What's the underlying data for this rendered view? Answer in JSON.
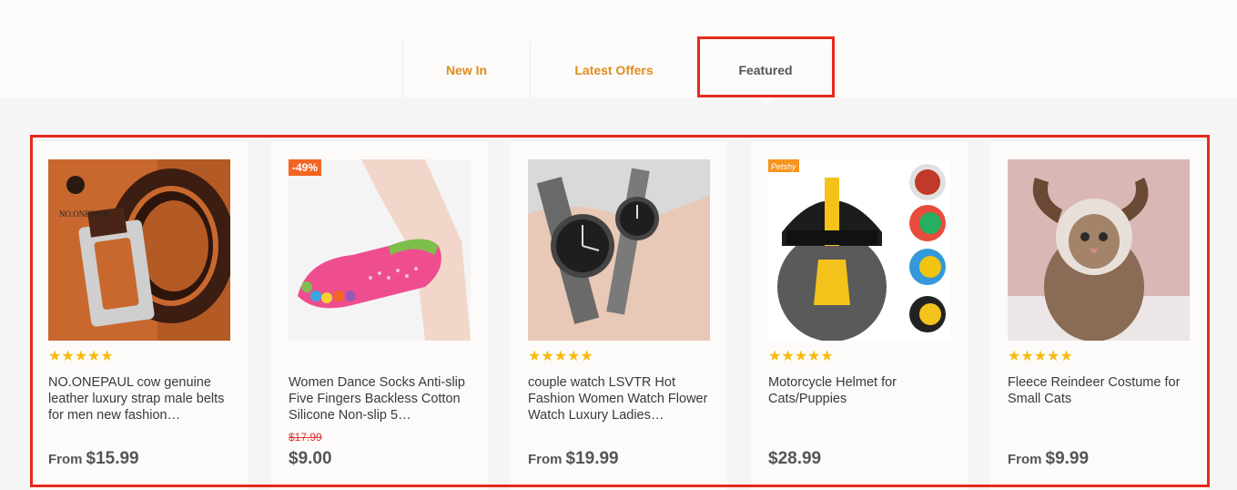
{
  "tabs": [
    {
      "label": "New In"
    },
    {
      "label": "Latest Offers"
    },
    {
      "label": "Featured",
      "active": true
    }
  ],
  "products": [
    {
      "title": "NO.ONEPAUL cow genuine leather luxury strap male belts for men new fashion…",
      "stars": "★★★★★",
      "rating": 4.5,
      "price_prefix": "From",
      "price": "$15.99",
      "image_icon": "leather-belt",
      "logo_text": "NO.ONEPAUL"
    },
    {
      "title": "Women Dance Socks Anti-slip Five Fingers Backless Cotton Silicone Non-slip 5…",
      "stars": "★★★★★",
      "rating": 0,
      "badge": "-49%",
      "old_price": "$17.99",
      "price": "$9.00",
      "image_icon": "toe-socks"
    },
    {
      "title": "couple watch LSVTR Hot Fashion Women Watch Flower Watch Luxury Ladies…",
      "stars": "★★★★★",
      "rating": 4.5,
      "price_prefix": "From",
      "price": "$19.99",
      "image_icon": "wrist-watches"
    },
    {
      "title": "Motorcycle Helmet for Cats/Puppies",
      "stars": "★★★★★",
      "rating": 4.5,
      "price": "$28.99",
      "image_icon": "cat-helmet",
      "brand_text": "Petshy"
    },
    {
      "title": "Fleece Reindeer Costume for Small Cats",
      "stars": "★★★★★",
      "rating": 4.5,
      "price_prefix": "From",
      "price": "$9.99",
      "image_icon": "cat-reindeer-costume"
    }
  ],
  "colors": {
    "accent": "#e08c1f",
    "star": "#f6bb0e",
    "highlight": "#e8291c",
    "sale": "#f26522"
  }
}
